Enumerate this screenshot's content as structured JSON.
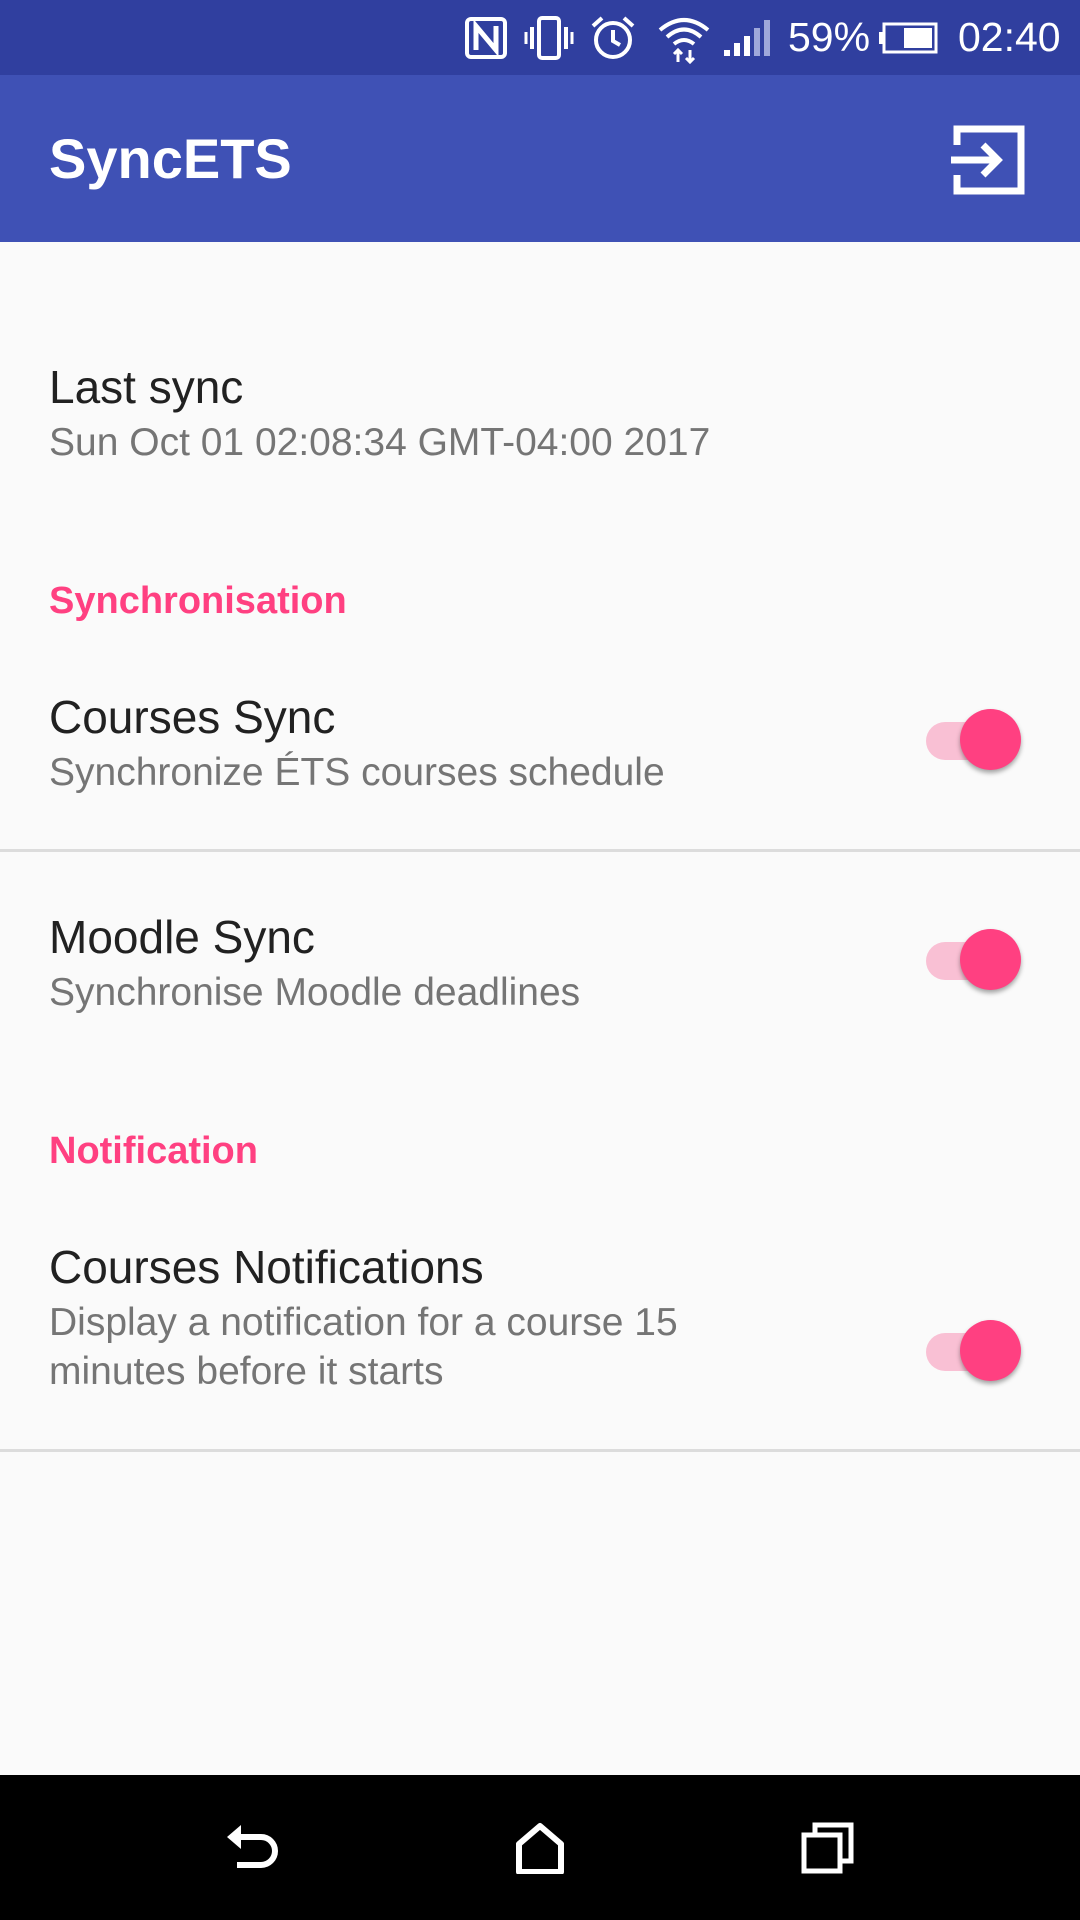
{
  "status_bar": {
    "battery_percent": "59%",
    "time": "02:40",
    "icons": [
      "nfc-icon",
      "vibrate-icon",
      "alarm-icon",
      "wifi-icon",
      "signal-icon",
      "battery-icon"
    ]
  },
  "app_bar": {
    "title": "SyncETS",
    "action_icon": "logout-icon"
  },
  "last_sync": {
    "title": "Last sync",
    "summary": "Sun Oct 01 02:08:34 GMT-04:00 2017"
  },
  "categories": {
    "synchronisation": "Synchronisation",
    "notification": "Notification"
  },
  "preferences": {
    "courses_sync": {
      "title": "Courses Sync",
      "summary": "Synchronize ÉTS courses schedule",
      "enabled": true
    },
    "moodle_sync": {
      "title": "Moodle Sync",
      "summary": "Synchronise Moodle deadlines",
      "enabled": true
    },
    "courses_notifications": {
      "title": "Courses Notifications",
      "summary": "Display a notification for a course 15 minutes before it starts",
      "enabled": true
    }
  },
  "nav_bar": {
    "icons": [
      "back-icon",
      "home-icon",
      "recents-icon"
    ]
  },
  "colors": {
    "status_bar": "#303f9f",
    "primary": "#3f51b5",
    "accent": "#ff4081",
    "switch_track": "#f9c0d4",
    "background": "#fafafa"
  }
}
